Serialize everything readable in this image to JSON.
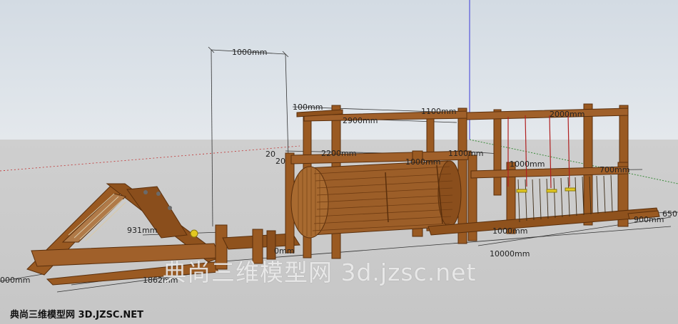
{
  "viewport": {
    "sky_color": "#dde3e9",
    "ground_color": "#c9c9c9",
    "wood_color": "#9a5a22",
    "wood_dark": "#6e3b12"
  },
  "dimensions": {
    "d1": "1000mm",
    "d2": "100mm",
    "d3": "1100mm",
    "d4": "2900mm",
    "d5": "2200mm",
    "d6": "1100mm",
    "d7": "1000mm",
    "d8": "1000mm",
    "d9": "700mm",
    "d10": "2000mm",
    "d11": "1000mm",
    "d12": "10000mm",
    "d13": "931mm",
    "d14": "1862mm",
    "d15": "000mm",
    "d16": "900mm",
    "d17": "20",
    "d18": "20",
    "d19": "650",
    "d20": "0mm"
  },
  "watermark": {
    "main": "典尚三维模型网 3d.jzsc.net",
    "corner": "典尚三维模型网 3D.JZSC.NET"
  }
}
